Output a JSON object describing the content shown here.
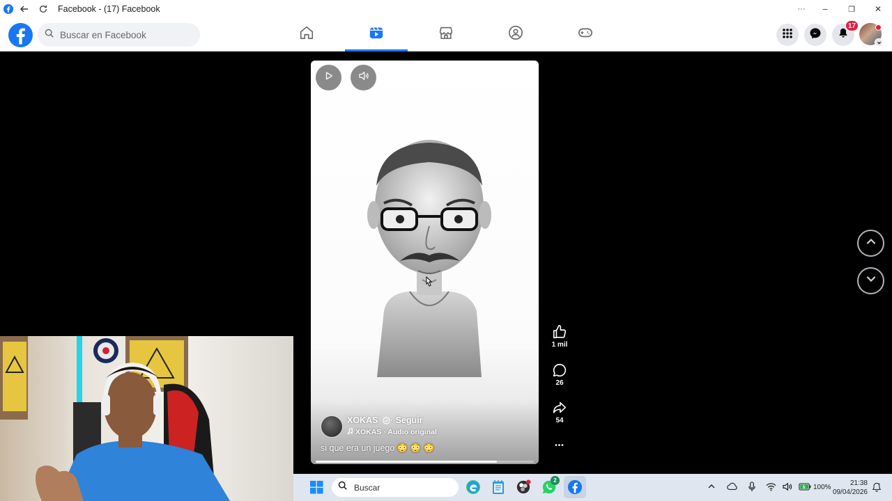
{
  "window": {
    "title": "Facebook - (17) Facebook",
    "controls": {
      "extensions_glyph": "···",
      "minimize_glyph": "–",
      "restore_glyph": "❐",
      "close_glyph": "✕"
    }
  },
  "header": {
    "search_placeholder": "Buscar en Facebook",
    "nav_tabs": [
      {
        "name": "home",
        "icon": "home-icon",
        "active": false
      },
      {
        "name": "video",
        "icon": "video-icon",
        "active": true
      },
      {
        "name": "marketplace",
        "icon": "marketplace-icon",
        "active": false
      },
      {
        "name": "groups",
        "icon": "groups-icon",
        "active": false
      },
      {
        "name": "gaming",
        "icon": "gaming-icon",
        "active": false
      }
    ],
    "notifications_count": "17"
  },
  "reel": {
    "author": "XOKAS",
    "follow_label": "· Seguir",
    "audio": "XOKAS · Audio original",
    "caption": "si que era un juego 😳 😳 😳",
    "progress": 0.83,
    "likes": "1 mil",
    "comments": "26",
    "shares": "54",
    "more_glyph": "•••"
  },
  "taskbar": {
    "search_placeholder": "Buscar",
    "whatsapp_badge": "2",
    "battery": "100%",
    "time": "21:38",
    "date": "09/04/2026"
  },
  "colors": {
    "brand": "#1877f2",
    "notification_badge": "#e41e3f"
  }
}
